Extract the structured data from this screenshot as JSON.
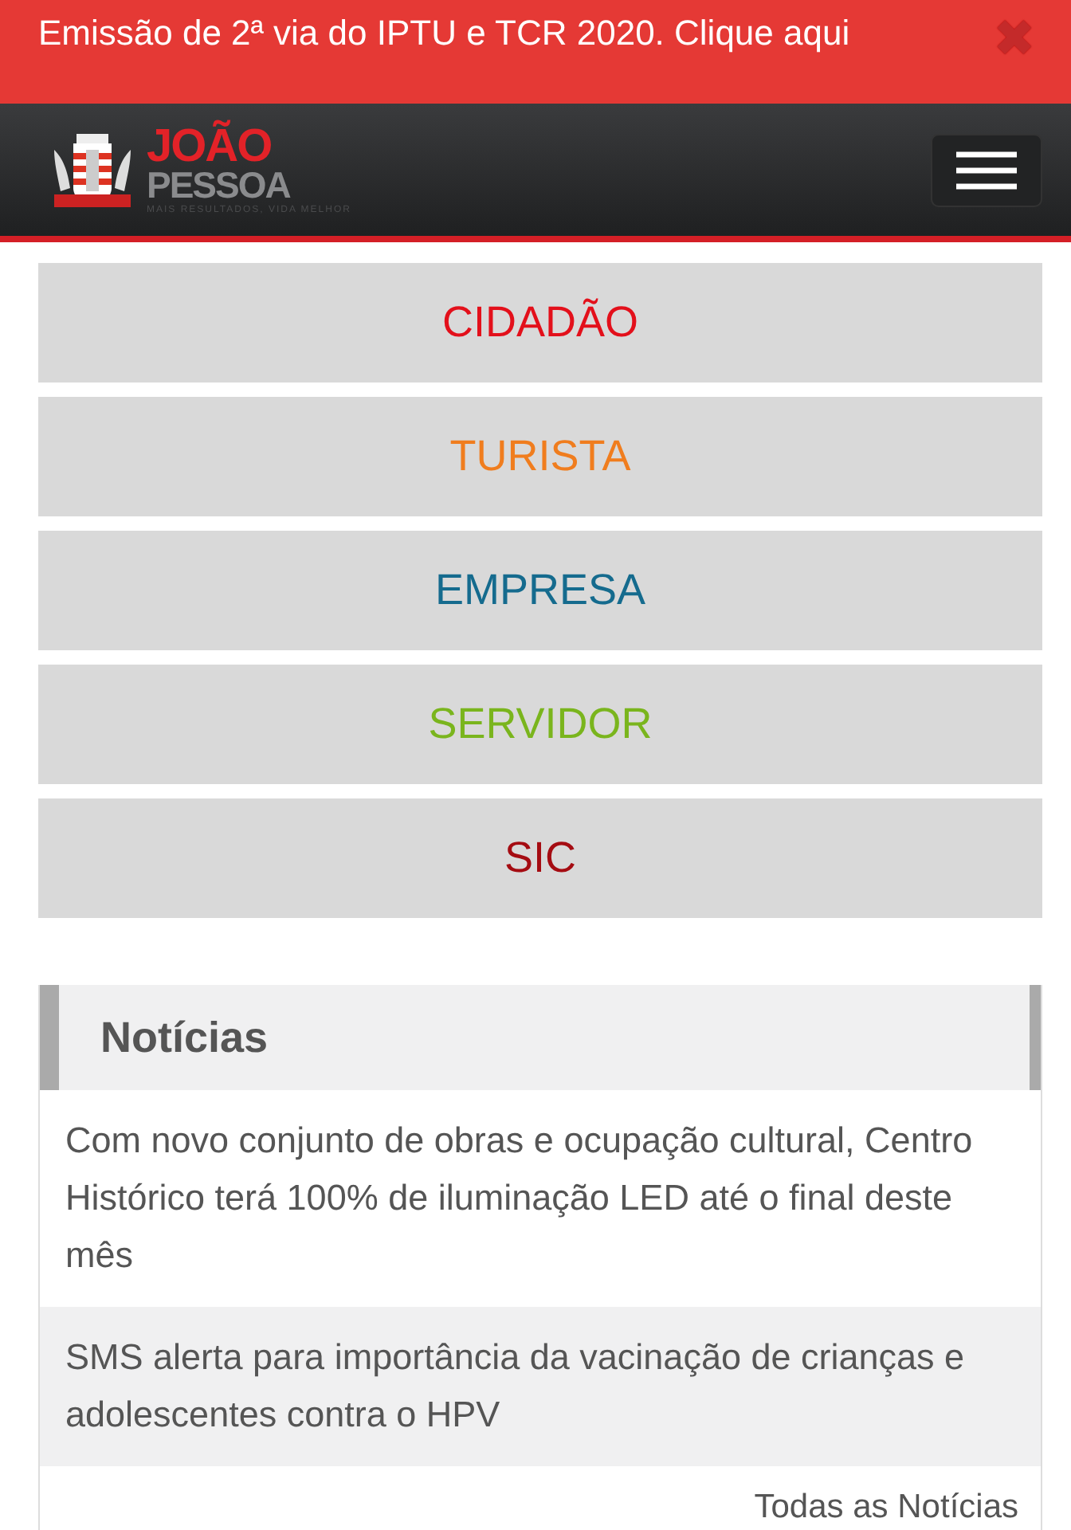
{
  "banner": {
    "text": "Emissão de 2ª via do IPTU e TCR 2020. Clique aqui",
    "close": "✖"
  },
  "header": {
    "logo_top": "JOÃO",
    "logo_bottom": "PESSOA",
    "tagline": "MAIS RESULTADOS, VIDA MELHOR"
  },
  "menu": [
    {
      "label": "CIDADÃO",
      "color": "#e3101b"
    },
    {
      "label": "TURISTA",
      "color": "#f07d1e"
    },
    {
      "label": "EMPRESA",
      "color": "#156b8e"
    },
    {
      "label": "SERVIDOR",
      "color": "#7ab51d"
    },
    {
      "label": "SIC",
      "color": "#a50c12"
    }
  ],
  "news": {
    "title": "Notícias",
    "items": [
      {
        "text": "Com novo conjunto de obras e ocupação cultural, Centro Histórico terá 100% de iluminação LED até o final deste mês"
      },
      {
        "text": "SMS alerta para importância da vacinação de crianças e adolescentes contra o HPV"
      }
    ],
    "more": "Todas as Notícias"
  }
}
